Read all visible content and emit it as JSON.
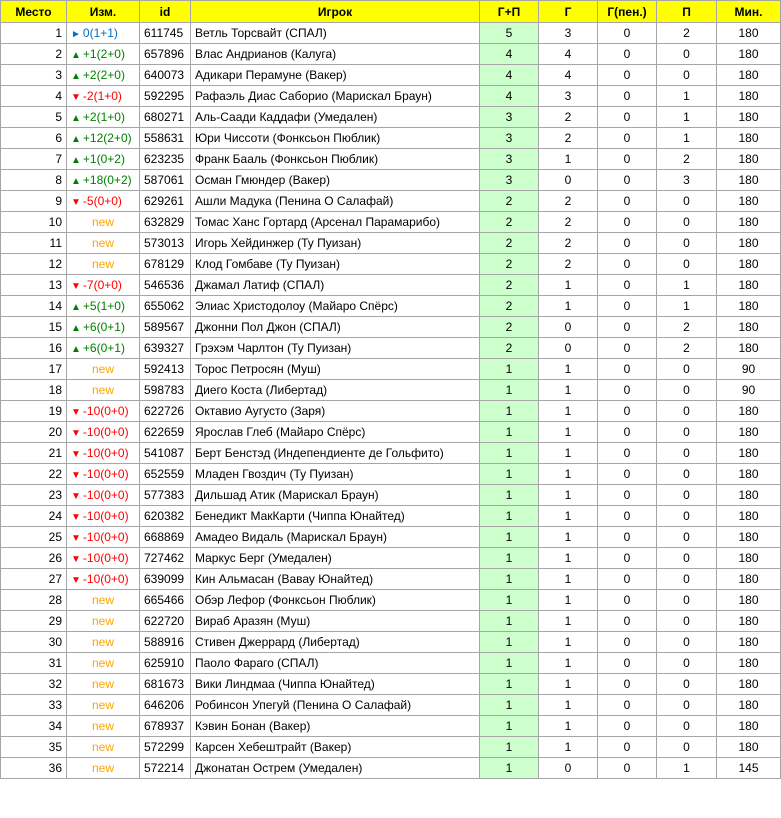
{
  "columns": [
    "Место",
    "Изм.",
    "id",
    "Игрок",
    "Г+П",
    "Г",
    "Г(пен.)",
    "П",
    "Мин."
  ],
  "colors": {
    "header": "#ffff00",
    "gp_cell": "#ccffcc",
    "up": "#008000",
    "down": "#ff0000",
    "same": "#0070c0",
    "new": "#ffa500"
  },
  "rows": [
    {
      "rank": "1",
      "dir": "same",
      "chg": "0(1+1)",
      "id": "611745",
      "player": "Ветль Торсвайт (СПАЛ)",
      "gp": "5",
      "g": "3",
      "pen": "0",
      "a": "2",
      "min": "180"
    },
    {
      "rank": "2",
      "dir": "up",
      "chg": "+1(2+0)",
      "id": "657896",
      "player": "Влас Андрианов (Калуга)",
      "gp": "4",
      "g": "4",
      "pen": "0",
      "a": "0",
      "min": "180"
    },
    {
      "rank": "3",
      "dir": "up",
      "chg": "+2(2+0)",
      "id": "640073",
      "player": "Адикари Перамуне (Вакер)",
      "gp": "4",
      "g": "4",
      "pen": "0",
      "a": "0",
      "min": "180"
    },
    {
      "rank": "4",
      "dir": "down",
      "chg": "-2(1+0)",
      "id": "592295",
      "player": "Рафаэль Диас Саборио (Марискал Браун)",
      "gp": "4",
      "g": "3",
      "pen": "0",
      "a": "1",
      "min": "180"
    },
    {
      "rank": "5",
      "dir": "up",
      "chg": "+2(1+0)",
      "id": "680271",
      "player": "Аль-Саади Каддафи (Умедален)",
      "gp": "3",
      "g": "2",
      "pen": "0",
      "a": "1",
      "min": "180"
    },
    {
      "rank": "6",
      "dir": "up",
      "chg": "+12(2+0)",
      "id": "558631",
      "player": "Юри Чиссоти (Фонксьон Пюблик)",
      "gp": "3",
      "g": "2",
      "pen": "0",
      "a": "1",
      "min": "180"
    },
    {
      "rank": "7",
      "dir": "up",
      "chg": "+1(0+2)",
      "id": "623235",
      "player": "Франк Бааль (Фонксьон Пюблик)",
      "gp": "3",
      "g": "1",
      "pen": "0",
      "a": "2",
      "min": "180"
    },
    {
      "rank": "8",
      "dir": "up",
      "chg": "+18(0+2)",
      "id": "587061",
      "player": "Осман Гмюндер (Вакер)",
      "gp": "3",
      "g": "0",
      "pen": "0",
      "a": "3",
      "min": "180"
    },
    {
      "rank": "9",
      "dir": "down",
      "chg": "-5(0+0)",
      "id": "629261",
      "player": "Ашли Мадука (Пенина О Салафай)",
      "gp": "2",
      "g": "2",
      "pen": "0",
      "a": "0",
      "min": "180"
    },
    {
      "rank": "10",
      "dir": "new",
      "chg": "new",
      "id": "632829",
      "player": "Томас Ханс Гортард (Арсенал Парамарибо)",
      "gp": "2",
      "g": "2",
      "pen": "0",
      "a": "0",
      "min": "180"
    },
    {
      "rank": "11",
      "dir": "new",
      "chg": "new",
      "id": "573013",
      "player": "Игорь Хейдинжер (Ту Пуизан)",
      "gp": "2",
      "g": "2",
      "pen": "0",
      "a": "0",
      "min": "180"
    },
    {
      "rank": "12",
      "dir": "new",
      "chg": "new",
      "id": "678129",
      "player": "Клод Гомбаве (Ту Пуизан)",
      "gp": "2",
      "g": "2",
      "pen": "0",
      "a": "0",
      "min": "180"
    },
    {
      "rank": "13",
      "dir": "down",
      "chg": "-7(0+0)",
      "id": "546536",
      "player": "Джамал Латиф (СПАЛ)",
      "gp": "2",
      "g": "1",
      "pen": "0",
      "a": "1",
      "min": "180"
    },
    {
      "rank": "14",
      "dir": "up",
      "chg": "+5(1+0)",
      "id": "655062",
      "player": "Элиас Христодолоу (Майаро Спёрс)",
      "gp": "2",
      "g": "1",
      "pen": "0",
      "a": "1",
      "min": "180"
    },
    {
      "rank": "15",
      "dir": "up",
      "chg": "+6(0+1)",
      "id": "589567",
      "player": "Джонни Пол Джон (СПАЛ)",
      "gp": "2",
      "g": "0",
      "pen": "0",
      "a": "2",
      "min": "180"
    },
    {
      "rank": "16",
      "dir": "up",
      "chg": "+6(0+1)",
      "id": "639327",
      "player": "Грэхэм Чарлтон (Ту Пуизан)",
      "gp": "2",
      "g": "0",
      "pen": "0",
      "a": "2",
      "min": "180"
    },
    {
      "rank": "17",
      "dir": "new",
      "chg": "new",
      "id": "592413",
      "player": "Торос Петросян (Муш)",
      "gp": "1",
      "g": "1",
      "pen": "0",
      "a": "0",
      "min": "90"
    },
    {
      "rank": "18",
      "dir": "new",
      "chg": "new",
      "id": "598783",
      "player": "Диего Коста (Либертад)",
      "gp": "1",
      "g": "1",
      "pen": "0",
      "a": "0",
      "min": "90"
    },
    {
      "rank": "19",
      "dir": "down",
      "chg": "-10(0+0)",
      "id": "622726",
      "player": "Октавио Аугусто (Заря)",
      "gp": "1",
      "g": "1",
      "pen": "0",
      "a": "0",
      "min": "180"
    },
    {
      "rank": "20",
      "dir": "down",
      "chg": "-10(0+0)",
      "id": "622659",
      "player": "Ярослав Глеб (Майаро Спёрс)",
      "gp": "1",
      "g": "1",
      "pen": "0",
      "a": "0",
      "min": "180"
    },
    {
      "rank": "21",
      "dir": "down",
      "chg": "-10(0+0)",
      "id": "541087",
      "player": "Берт Бенстэд (Индепендиенте де Гольфито)",
      "gp": "1",
      "g": "1",
      "pen": "0",
      "a": "0",
      "min": "180"
    },
    {
      "rank": "22",
      "dir": "down",
      "chg": "-10(0+0)",
      "id": "652559",
      "player": "Младен Гвоздич (Ту Пуизан)",
      "gp": "1",
      "g": "1",
      "pen": "0",
      "a": "0",
      "min": "180"
    },
    {
      "rank": "23",
      "dir": "down",
      "chg": "-10(0+0)",
      "id": "577383",
      "player": "Дильшад Атик (Марискал Браун)",
      "gp": "1",
      "g": "1",
      "pen": "0",
      "a": "0",
      "min": "180"
    },
    {
      "rank": "24",
      "dir": "down",
      "chg": "-10(0+0)",
      "id": "620382",
      "player": "Бенедикт МакКарти (Чиппа Юнайтед)",
      "gp": "1",
      "g": "1",
      "pen": "0",
      "a": "0",
      "min": "180"
    },
    {
      "rank": "25",
      "dir": "down",
      "chg": "-10(0+0)",
      "id": "668869",
      "player": "Амадео Видаль (Марискал Браун)",
      "gp": "1",
      "g": "1",
      "pen": "0",
      "a": "0",
      "min": "180"
    },
    {
      "rank": "26",
      "dir": "down",
      "chg": "-10(0+0)",
      "id": "727462",
      "player": "Маркус Берг (Умедален)",
      "gp": "1",
      "g": "1",
      "pen": "0",
      "a": "0",
      "min": "180"
    },
    {
      "rank": "27",
      "dir": "down",
      "chg": "-10(0+0)",
      "id": "639099",
      "player": "Кин Альмасан (Вавау Юнайтед)",
      "gp": "1",
      "g": "1",
      "pen": "0",
      "a": "0",
      "min": "180"
    },
    {
      "rank": "28",
      "dir": "new",
      "chg": "new",
      "id": "665466",
      "player": "Обэр Лефор (Фонксьон Пюблик)",
      "gp": "1",
      "g": "1",
      "pen": "0",
      "a": "0",
      "min": "180"
    },
    {
      "rank": "29",
      "dir": "new",
      "chg": "new",
      "id": "622720",
      "player": "Вираб Аразян (Муш)",
      "gp": "1",
      "g": "1",
      "pen": "0",
      "a": "0",
      "min": "180"
    },
    {
      "rank": "30",
      "dir": "new",
      "chg": "new",
      "id": "588916",
      "player": "Стивен Джеррард (Либертад)",
      "gp": "1",
      "g": "1",
      "pen": "0",
      "a": "0",
      "min": "180"
    },
    {
      "rank": "31",
      "dir": "new",
      "chg": "new",
      "id": "625910",
      "player": "Паоло Фараго (СПАЛ)",
      "gp": "1",
      "g": "1",
      "pen": "0",
      "a": "0",
      "min": "180"
    },
    {
      "rank": "32",
      "dir": "new",
      "chg": "new",
      "id": "681673",
      "player": "Вики Линдмаа (Чиппа Юнайтед)",
      "gp": "1",
      "g": "1",
      "pen": "0",
      "a": "0",
      "min": "180"
    },
    {
      "rank": "33",
      "dir": "new",
      "chg": "new",
      "id": "646206",
      "player": "Робинсон Упегуй (Пенина О Салафай)",
      "gp": "1",
      "g": "1",
      "pen": "0",
      "a": "0",
      "min": "180"
    },
    {
      "rank": "34",
      "dir": "new",
      "chg": "new",
      "id": "678937",
      "player": "Кэвин Бонан (Вакер)",
      "gp": "1",
      "g": "1",
      "pen": "0",
      "a": "0",
      "min": "180"
    },
    {
      "rank": "35",
      "dir": "new",
      "chg": "new",
      "id": "572299",
      "player": "Карсен Хебештрайт (Вакер)",
      "gp": "1",
      "g": "1",
      "pen": "0",
      "a": "0",
      "min": "180"
    },
    {
      "rank": "36",
      "dir": "new",
      "chg": "new",
      "id": "572214",
      "player": "Джонатан Острем (Умедален)",
      "gp": "1",
      "g": "0",
      "pen": "0",
      "a": "1",
      "min": "145"
    }
  ]
}
